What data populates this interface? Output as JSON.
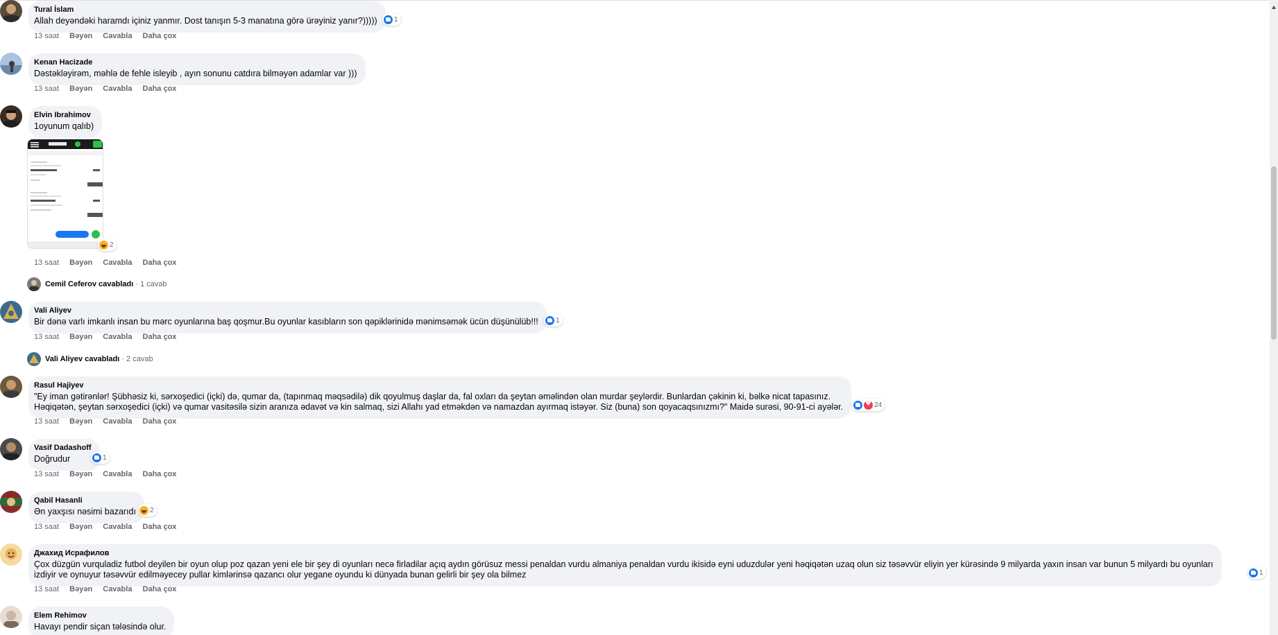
{
  "actions": {
    "like": "Bəyən",
    "reply": "Cavabla",
    "more": "Daha çox"
  },
  "comments": [
    {
      "name": "Tural İslam",
      "text": "Allah deyəndəki haramdı içiniz yanmır. Dost tanışın 5-3 manatına görə ürəyiniz yanır?)))))",
      "time": "13 saat",
      "reaction_count": "1",
      "reactions": [
        "like"
      ],
      "avatar_color": "#5a4a3a"
    },
    {
      "name": "Kenan Hacizade",
      "text": "Dəstəkləyirəm, məhlə de fehle isleyib , ayın sonunu catdıra bilməyən adamlar var )))",
      "time": "13 saat",
      "avatar_color": "#7a9cc0"
    },
    {
      "name": "Elvin Ibrahimov",
      "text": "1oyunum qalıb)",
      "time": "13 saat",
      "reaction_count": "2",
      "reactions": [
        "haha"
      ],
      "avatar_color": "#3a2c22"
    },
    {
      "name": "Vali Aliyev",
      "text": "Bir dənə varlı imkanlı insan bu mərc oyunlarına baş qoşmur.Bu oyunlar kasıbların son qəpiklərinidə mənimsəmək ücün düşünülüb!!!",
      "time": "13 saat",
      "reaction_count": "1",
      "reactions": [
        "like"
      ],
      "avatar_color": "#3d6b8f"
    },
    {
      "name": "Rasul Hajiyev",
      "text": "\"Ey iman gətirənlər! Şübhəsiz ki, sərxoşedici (içki) də, qumar da, (tapınmaq məqsədilə) dik qoyulmuş daşlar da, fal oxları da şeytan əməlindən olan murdar şeylərdir. Bunlardan çəkinin ki, bəlkə nicat tapasınız.\nHəqiqətən, şeytan sərxoşedici (içki) və qumar vasitəsilə sizin aranıza ədavət və kin salmaq, sizi Allahı yad etməkdən və namazdan ayırmaq istəyər. Siz (buna) son qoyacaqsınızmı?\" Maidə surəsi, 90-91-ci ayələr.",
      "time": "13 saat",
      "reaction_count": "24",
      "reactions": [
        "like",
        "love"
      ],
      "avatar_color": "#6b5a3c"
    },
    {
      "name": "Vasif Dadashoff",
      "text": "Doğrudur",
      "time": "13 saat",
      "reaction_count": "1",
      "reactions": [
        "like"
      ],
      "avatar_color": "#4a4a4a"
    },
    {
      "name": "Qabil Hasanli",
      "text": "Ən yaxşısı nəsimi bazarıdı",
      "time": "13 saat",
      "reaction_count": "2",
      "reactions": [
        "haha"
      ],
      "avatar_color": "#8b2a2a"
    },
    {
      "name": "Джахид Исрафилов",
      "text": "Çox düzgün vurquladiz futbol deyilen bir oyun olup poz qazan yeni ele bir şey di oyunları necə firladilar açıq aydın görüsuz messi penaldan vurdu almaniya penaldan vurdu ikisidə eyni uduzdulər yeni həqiqətən uzaq olun siz təsəvvür eliyin yer kürəsində 9 milyarda yaxın insan var bunun 5 milyardı bu oyunları\nizdiyir ve oynuyur təsəvvür edilməyecey pullar kimlərinsə qazancı olur yegane oyundu ki dünyada bunan gelirli bir şey ola bilmez",
      "time": "13 saat",
      "reaction_count": "1",
      "reactions": [
        "like"
      ],
      "avatar_color": "#e8b060"
    },
    {
      "name": "Elem Rehimov",
      "text": "Havayı pendir siçan tələsində olur.",
      "avatar_color": "#c8b8a8"
    }
  ],
  "reply_summaries": [
    {
      "name": "Cemil Ceferov",
      "verb": "cavabladı",
      "count": "1 cavab"
    },
    {
      "name": "Vali Aliyev",
      "verb": "cavabladı",
      "count": "2 cavab"
    }
  ]
}
